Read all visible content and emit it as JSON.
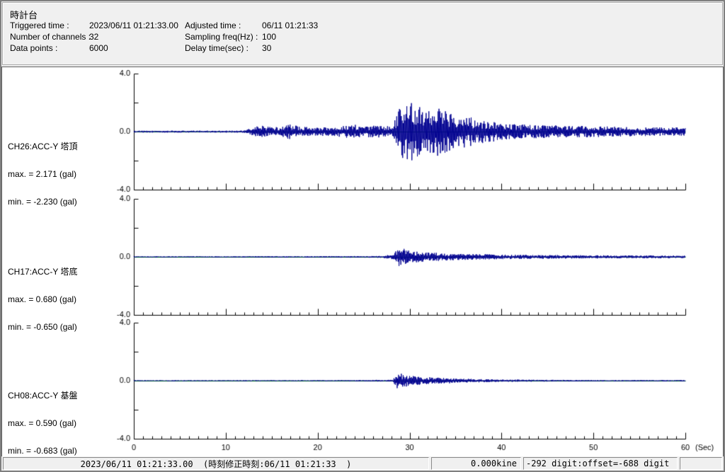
{
  "header": {
    "title": "時計台",
    "rows": [
      {
        "l1": "Triggered time :",
        "v1": "2023/06/11 01:21:33.00",
        "l2": "Adjusted time :",
        "v2": "06/11 01:21:33"
      },
      {
        "l1": "Number of channels :",
        "v1": "32",
        "l2": "Sampling freq(Hz) :",
        "v2": "100"
      },
      {
        "l1": "Data points :",
        "v1": "6000",
        "l2": "Delay time(sec) :",
        "v2": "30"
      }
    ]
  },
  "chart_data": {
    "type": "line",
    "title": "",
    "axes": {
      "xlim": [
        0,
        60
      ],
      "xtick_major": [
        0,
        10,
        20,
        30,
        40,
        50,
        60
      ],
      "xtick_minor_step": 1,
      "x_unit_label": "(Sec)",
      "ylim": [
        -4.0,
        4.0
      ],
      "ytick_values": [
        4,
        2,
        0,
        -2,
        -4
      ],
      "ytick_labels": [
        {
          "value": 4,
          "label": "4.0"
        },
        {
          "value": 0,
          "label": "0.0"
        },
        {
          "value": -4,
          "label": "-4.0"
        }
      ],
      "grid": false,
      "axis_color": "#000000",
      "zero_line_color": "#00A000",
      "trace_color": "#000090"
    },
    "channels": [
      {
        "channel": "CH26:ACC-Y 塔頂",
        "max_label": "max. = 2.171 (gal)",
        "min_label": "min. = -2.230 (gal)",
        "max_gal": 2.171,
        "min_gal": -2.23,
        "unit": "gal",
        "envelope": [
          [
            0,
            0.06
          ],
          [
            12,
            0.07
          ],
          [
            12.5,
            0.18
          ],
          [
            13,
            0.3
          ],
          [
            14,
            0.45
          ],
          [
            15,
            0.3
          ],
          [
            16,
            0.33
          ],
          [
            17,
            0.55
          ],
          [
            18,
            0.35
          ],
          [
            20,
            0.28
          ],
          [
            22,
            0.32
          ],
          [
            24,
            0.5
          ],
          [
            25,
            0.35
          ],
          [
            26,
            0.45
          ],
          [
            27,
            0.38
          ],
          [
            28,
            0.45
          ],
          [
            28.6,
            1.2
          ],
          [
            29,
            2.2
          ],
          [
            29.5,
            1.9
          ],
          [
            30,
            2.1
          ],
          [
            31,
            1.9
          ],
          [
            32,
            1.8
          ],
          [
            33,
            1.7
          ],
          [
            34,
            1.5
          ],
          [
            35,
            1.3
          ],
          [
            36,
            1.1
          ],
          [
            37,
            0.95
          ],
          [
            38,
            0.8
          ],
          [
            40,
            0.6
          ],
          [
            42,
            0.5
          ],
          [
            45,
            0.45
          ],
          [
            48,
            0.4
          ],
          [
            52,
            0.35
          ],
          [
            56,
            0.3
          ],
          [
            60,
            0.28
          ]
        ]
      },
      {
        "channel": "CH17:ACC-Y 塔底",
        "max_label": "max. = 0.680 (gal)",
        "min_label": "min. = -0.650 (gal)",
        "max_gal": 0.68,
        "min_gal": -0.65,
        "unit": "gal",
        "envelope": [
          [
            0,
            0.04
          ],
          [
            15,
            0.045
          ],
          [
            20,
            0.05
          ],
          [
            27,
            0.06
          ],
          [
            28.3,
            0.2
          ],
          [
            28.8,
            0.68
          ],
          [
            29.5,
            0.6
          ],
          [
            30,
            0.45
          ],
          [
            31,
            0.35
          ],
          [
            32,
            0.3
          ],
          [
            33,
            0.28
          ],
          [
            35,
            0.22
          ],
          [
            37,
            0.2
          ],
          [
            40,
            0.16
          ],
          [
            44,
            0.13
          ],
          [
            50,
            0.11
          ],
          [
            60,
            0.09
          ]
        ]
      },
      {
        "channel": "CH08:ACC-Y 基盤",
        "max_label": "max. = 0.590 (gal)",
        "min_label": "min. = -0.683 (gal)",
        "max_gal": 0.59,
        "min_gal": -0.683,
        "unit": "gal",
        "envelope": [
          [
            0,
            0.035
          ],
          [
            20,
            0.04
          ],
          [
            28.2,
            0.06
          ],
          [
            28.7,
            0.68
          ],
          [
            29.2,
            0.45
          ],
          [
            30,
            0.38
          ],
          [
            31,
            0.3
          ],
          [
            32,
            0.26
          ],
          [
            33,
            0.22
          ],
          [
            35,
            0.16
          ],
          [
            37,
            0.12
          ],
          [
            40,
            0.08
          ],
          [
            45,
            0.06
          ],
          [
            50,
            0.05
          ],
          [
            60,
            0.05
          ]
        ]
      }
    ]
  },
  "status_bar": {
    "time_text": "2023/06/11 01:21:33.00  (時刻修正時刻:06/11 01:21:33  )",
    "kine_text": "0.000kine",
    "digit_text": "-292 digit:offset=-688 digit",
    "empty_text": ""
  }
}
